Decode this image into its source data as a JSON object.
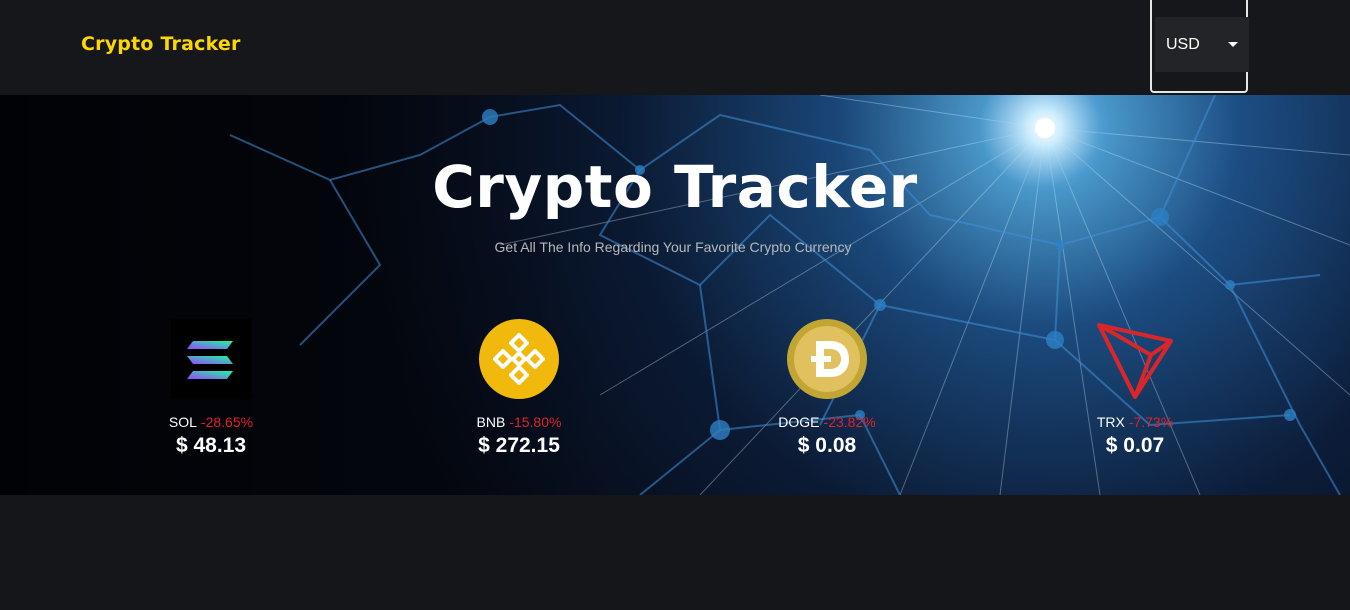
{
  "header": {
    "brand": "Crypto Tracker",
    "currency": {
      "selected": "USD"
    }
  },
  "hero": {
    "title": "Crypto Tracker",
    "subtitle": "Get All The Info Regarding Your Favorite Crypto Currency"
  },
  "coins": [
    {
      "symbol": "SOL",
      "change": "-28.65%",
      "price": "$ 48.13",
      "icon": "solana-logo-icon"
    },
    {
      "symbol": "BNB",
      "change": "-15.80%",
      "price": "$ 272.15",
      "icon": "binance-logo-icon"
    },
    {
      "symbol": "DOGE",
      "change": "-23.82%",
      "price": "$ 0.08",
      "icon": "dogecoin-logo-icon"
    },
    {
      "symbol": "TRX",
      "change": "-7.73%",
      "price": "$ 0.07",
      "icon": "tron-logo-icon"
    }
  ],
  "colors": {
    "brand": "#ffd700",
    "negative": "#e1212b",
    "background": "#14161a",
    "appbar": "#16171b"
  }
}
